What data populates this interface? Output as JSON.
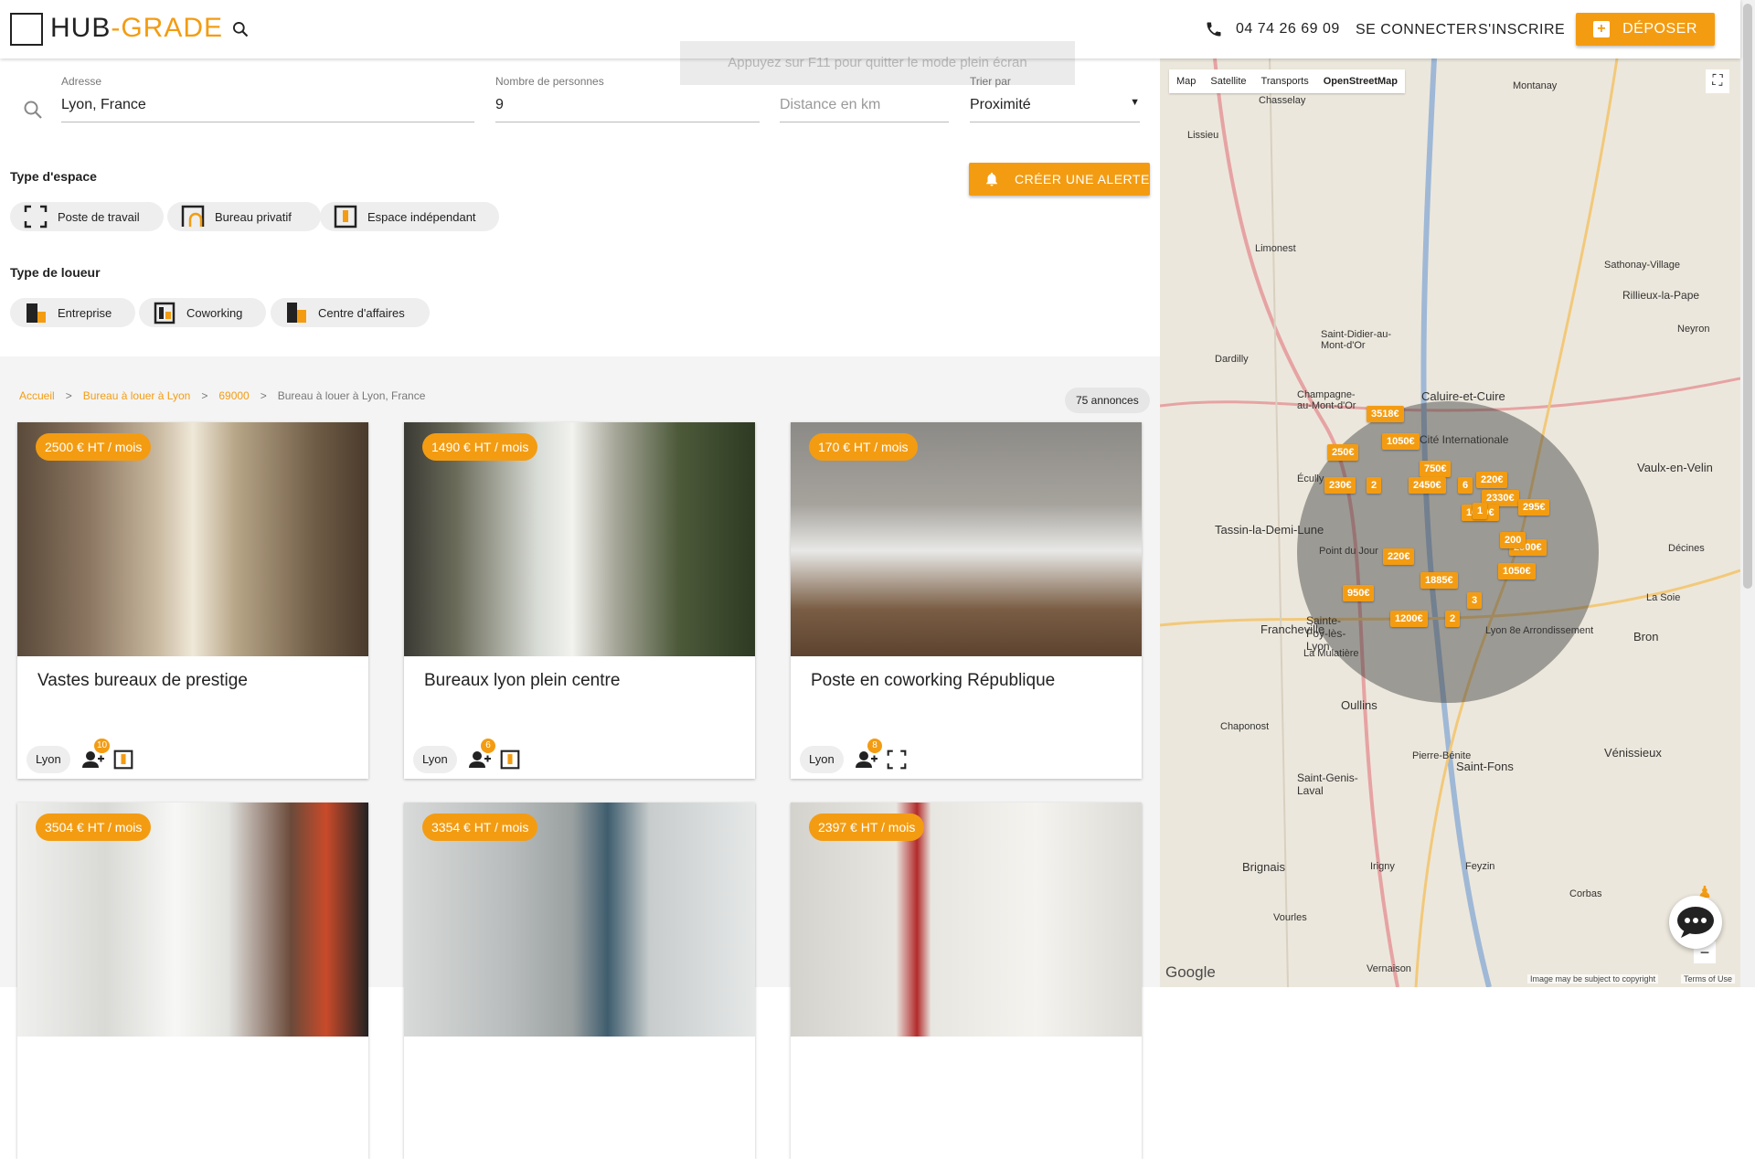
{
  "header": {
    "logo_left": "HUB",
    "logo_dash": "-",
    "logo_right": "GRADE",
    "phone": "04 74 26 69 09",
    "login": "SE CONNECTER",
    "signup": "S'INSCRIRE",
    "deposit": "DÉPOSER"
  },
  "toast": "Appuyez sur F11 pour quitter le mode plein écran",
  "search": {
    "address_label": "Adresse",
    "address_value": "Lyon, France",
    "persons_label": "Nombre de personnes",
    "persons_value": "9",
    "distance_placeholder": "Distance en km",
    "sort_label": "Trier par",
    "sort_value": "Proximité"
  },
  "space_type": {
    "title": "Type d'espace",
    "chips": [
      "Poste de travail",
      "Bureau privatif",
      "Espace indépendant"
    ]
  },
  "renter_type": {
    "title": "Type de loueur",
    "chips": [
      "Entreprise",
      "Coworking",
      "Centre d'affaires"
    ]
  },
  "alert_button": "CRÉER UNE ALERTE",
  "breadcrumb": {
    "items": [
      "Accueil",
      ">",
      "Bureau à louer à Lyon",
      ">",
      "69000",
      ">",
      "Bureau à louer à Lyon, France"
    ]
  },
  "count": "75 annonces",
  "cards": [
    {
      "price": "2500 € HT / mois",
      "title": "Vastes bureaux de prestige",
      "city": "Lyon",
      "persons": "10"
    },
    {
      "price": "1490 € HT / mois",
      "title": "Bureaux lyon plein centre",
      "city": "Lyon",
      "persons": "6"
    },
    {
      "price": "170 € HT / mois",
      "title": "Poste en coworking République",
      "city": "Lyon",
      "persons": "8"
    },
    {
      "price": "3504 € HT / mois",
      "title": "",
      "city": "",
      "persons": ""
    },
    {
      "price": "3354 € HT / mois",
      "title": "",
      "city": "",
      "persons": ""
    },
    {
      "price": "2397 € HT / mois",
      "title": "",
      "city": "",
      "persons": ""
    }
  ],
  "map": {
    "tabs": [
      "Map",
      "Satellite",
      "Transports",
      "OpenStreetMap"
    ],
    "pins": [
      "3518€",
      "250€",
      "1050€",
      "750€",
      "230€",
      "2",
      "2450€",
      "6",
      "220€",
      "2330€",
      "1600€",
      "295€",
      "1885€",
      "220€",
      "2500€",
      "950€",
      "1050€",
      "1200€",
      "2",
      "3",
      "1",
      "200"
    ],
    "places": [
      "Montanay",
      "Chasselay",
      "Lissieu",
      "Limonest",
      "Dardilly",
      "Caluire-et-Cuire",
      "Tassin-la-Demi-Lune",
      "Francheville",
      "Sainte-Foy-lès-Lyon",
      "Oullins",
      "Saint-Fons",
      "Vénissieux",
      "Vaulx-en-Velin",
      "Bron",
      "Rillieux-la-Pape",
      "Brignais",
      "Irigny",
      "Feyzin",
      "Corbas",
      "Cité Internationale",
      "Point du Jour",
      "Lyon 8e Arrondissement",
      "La Mulatière",
      "Saint-Genis-Laval",
      "Chaponost",
      "Pierre-Bénite",
      "Vernaison",
      "Vourles",
      "Saint-Didier-au-Mont-d'Or",
      "Sathonay-Village",
      "Neyron",
      "Décines",
      "La Soie",
      "Champagne-au-Mont-d'Or",
      "Écully"
    ],
    "attribution": "Image may be subject to copyright",
    "terms": "Terms of Use",
    "google": "Google"
  },
  "colors": {
    "accent": "#f39c12",
    "text": "#222222"
  }
}
